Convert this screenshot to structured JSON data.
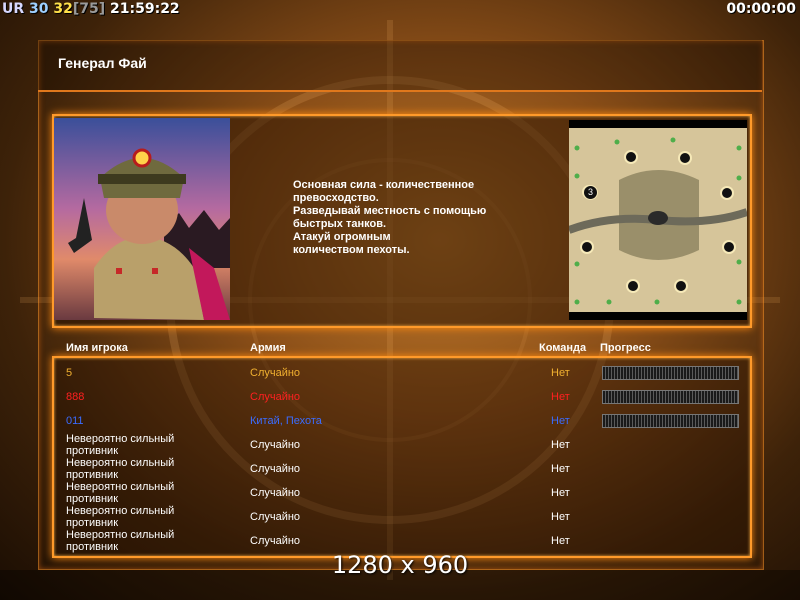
{
  "hud": {
    "tag": "UR",
    "value_a": "30",
    "value_b": "32",
    "value_c": "[75]",
    "clock": "21:59:22",
    "timer": "00:00:00"
  },
  "title": "Генерал Фай",
  "description": "Основная сила - количественное\n превосходство.\nРазведывай местность с помощью\n быстрых танков.\nАтакуй огромным\nколичеством пехоты.",
  "table": {
    "headers": {
      "player": "Имя игрока",
      "army": "Армия",
      "team": "Команда",
      "progress": "Прогресс"
    },
    "rows": [
      {
        "name": "5",
        "army": "Случайно",
        "team": "Нет",
        "color": "#f0b030",
        "progress": true
      },
      {
        "name": "888",
        "army": "Случайно",
        "team": "Нет",
        "color": "#ff2020",
        "progress": true
      },
      {
        "name": "011",
        "army": "Китай, Пехота",
        "team": "Нет",
        "color": "#3b6cff",
        "progress": true
      },
      {
        "name": "Невероятно сильный\n противник",
        "army": "Случайно",
        "team": "Нет",
        "color": "#ffffff",
        "progress": false
      },
      {
        "name": "Невероятно сильный\n противник",
        "army": "Случайно",
        "team": "Нет",
        "color": "#ffffff",
        "progress": false
      },
      {
        "name": "Невероятно сильный\n противник",
        "army": "Случайно",
        "team": "Нет",
        "color": "#ffffff",
        "progress": false
      },
      {
        "name": "Невероятно сильный\n противник",
        "army": "Случайно",
        "team": "Нет",
        "color": "#ffffff",
        "progress": false
      },
      {
        "name": "Невероятно сильный\n противник",
        "army": "Случайно",
        "team": "Нет",
        "color": "#ffffff",
        "progress": false
      }
    ]
  },
  "minimap_marker": "3",
  "resolution": "1280 x 960",
  "colors": {
    "accent": "#ff9a2a",
    "header_line": "#e0781c"
  }
}
